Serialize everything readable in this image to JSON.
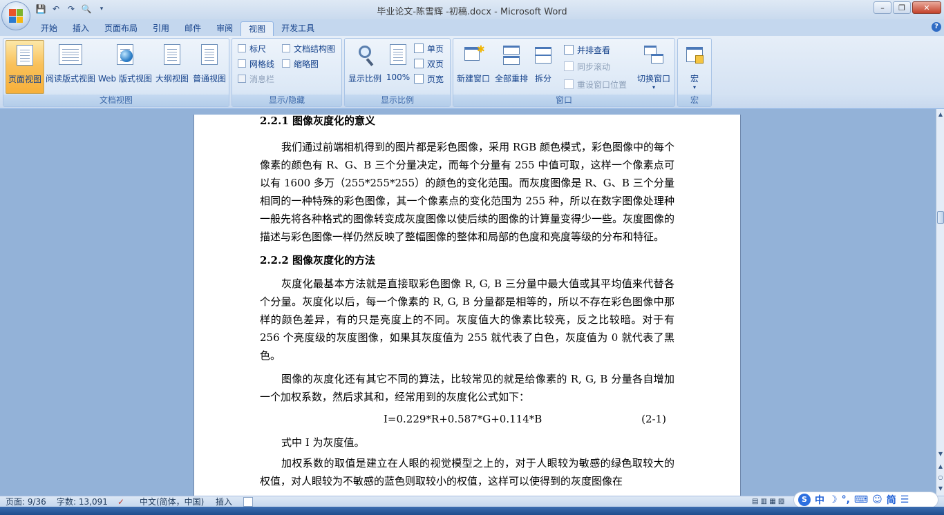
{
  "window": {
    "title": "毕业论文-陈雪辉 -初稿.docx - Microsoft Word",
    "controls": [
      "–",
      "❐",
      "✕"
    ]
  },
  "qat_icons": [
    "save-icon",
    "undo-icon",
    "redo-icon",
    "print-preview-icon"
  ],
  "tabs": [
    "开始",
    "插入",
    "页面布局",
    "引用",
    "邮件",
    "审阅",
    "视图",
    "开发工具"
  ],
  "active_tab": "视图",
  "ribbon": {
    "doc_views": {
      "label": "文档视图",
      "buttons": [
        "页面视图",
        "阅读版式视图",
        "Web 版式视图",
        "大纲视图",
        "普通视图"
      ]
    },
    "show_hide": {
      "label": "显示/隐藏",
      "items": [
        "标尺",
        "网格线",
        "消息栏",
        "文档结构图",
        "缩略图"
      ]
    },
    "zoom": {
      "label": "显示比例",
      "zoom_label": "显示比例",
      "percent_label": "100%",
      "one_page": "单页",
      "two_pages": "双页",
      "page_width": "页宽"
    },
    "window": {
      "label": "窗口",
      "new_window": "新建窗口",
      "arrange_all": "全部重排",
      "split": "拆分",
      "side_by_side": "并排查看",
      "sync_scroll": "同步滚动",
      "reset_position": "重设窗口位置",
      "switch_windows": "切换窗口"
    },
    "macros": {
      "label": "宏",
      "button": "宏"
    }
  },
  "document": {
    "heading1": "2.2.1 图像灰度化的意义",
    "para1": "我们通过前端相机得到的图片都是彩色图像，采用 RGB 颜色模式，彩色图像中的每个像素的颜色有 R、G、B 三个分量决定，而每个分量有 255 中值可取，这样一个像素点可以有 1600 多万（255*255*255）的颜色的变化范围。而灰度图像是 R、G、B 三个分量相同的一种特殊的彩色图像，其一个像素点的变化范围为 255 种，所以在数字图像处理种一般先将各种格式的图像转变成灰度图像以使后续的图像的计算量变得少一些。灰度图像的描述与彩色图像一样仍然反映了整幅图像的整体和局部的色度和亮度等级的分布和特征。",
    "heading2": "2.2.2 图像灰度化的方法",
    "para2": "灰度化最基本方法就是直接取彩色图像 R, G, B 三分量中最大值或其平均值来代替各个分量。灰度化以后，每一个像素的 R, G, B 分量都是相等的，所以不存在彩色图像中那样的颜色差异，有的只是亮度上的不同。灰度值大的像素比较亮，反之比较暗。对于有 256 个亮度级的灰度图像，如果其灰度值为 255 就代表了白色，灰度值为 0 就代表了黑色。",
    "para3": "图像的灰度化还有其它不同的算法，比较常见的就是给像素的 R, G, B 分量各自增加一个加权系数，然后求其和，经常用到的灰度化公式如下：",
    "formula": "I=0.229*R+0.587*G+0.114*B",
    "formula_no": "(2-1)",
    "para4": "式中 I 为灰度值。",
    "para5": "加权系数的取值是建立在人眼的视觉模型之上的，对于人眼较为敏感的绿色取较大的权值，对人眼较为不敏感的蓝色则取较小的权值，这样可以使得到的灰度图像在"
  },
  "status": {
    "page": "页面: 9/36",
    "words": "字数: 13,091",
    "language": "中文(简体，中国)",
    "mode": "插入"
  },
  "ime": {
    "lang": "中",
    "simplified": "简"
  }
}
